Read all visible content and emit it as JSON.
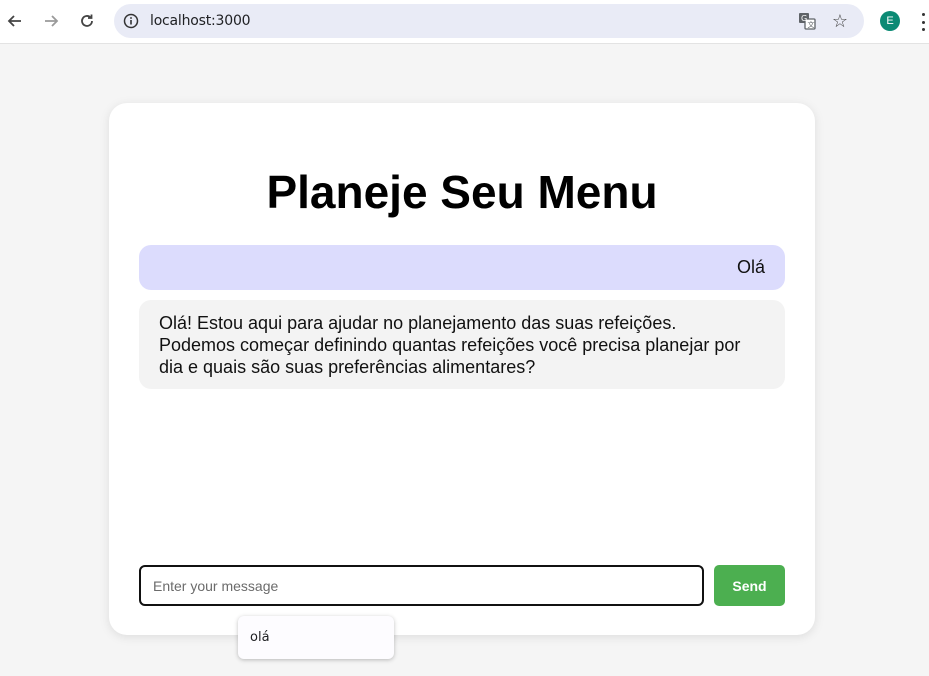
{
  "browser": {
    "url": "localhost:3000",
    "profile_initial": "E"
  },
  "page": {
    "title": "Planeje Seu Menu",
    "messages": [
      {
        "role": "user",
        "text": "Olá"
      },
      {
        "role": "bot",
        "text": "Olá! Estou aqui para ajudar no planejamento das suas refeições. Podemos começar definindo quantas refeições você precisa planejar por dia e quais são suas preferências alimentares?"
      }
    ],
    "input": {
      "placeholder": "Enter your message",
      "value": ""
    },
    "send_label": "Send"
  },
  "autocomplete": {
    "items": [
      "olá"
    ]
  },
  "colors": {
    "user_bubble": "#dcdcfd",
    "bot_bubble": "#f3f3f3",
    "send_button": "#4caf50",
    "profile": "#0b8a74"
  }
}
